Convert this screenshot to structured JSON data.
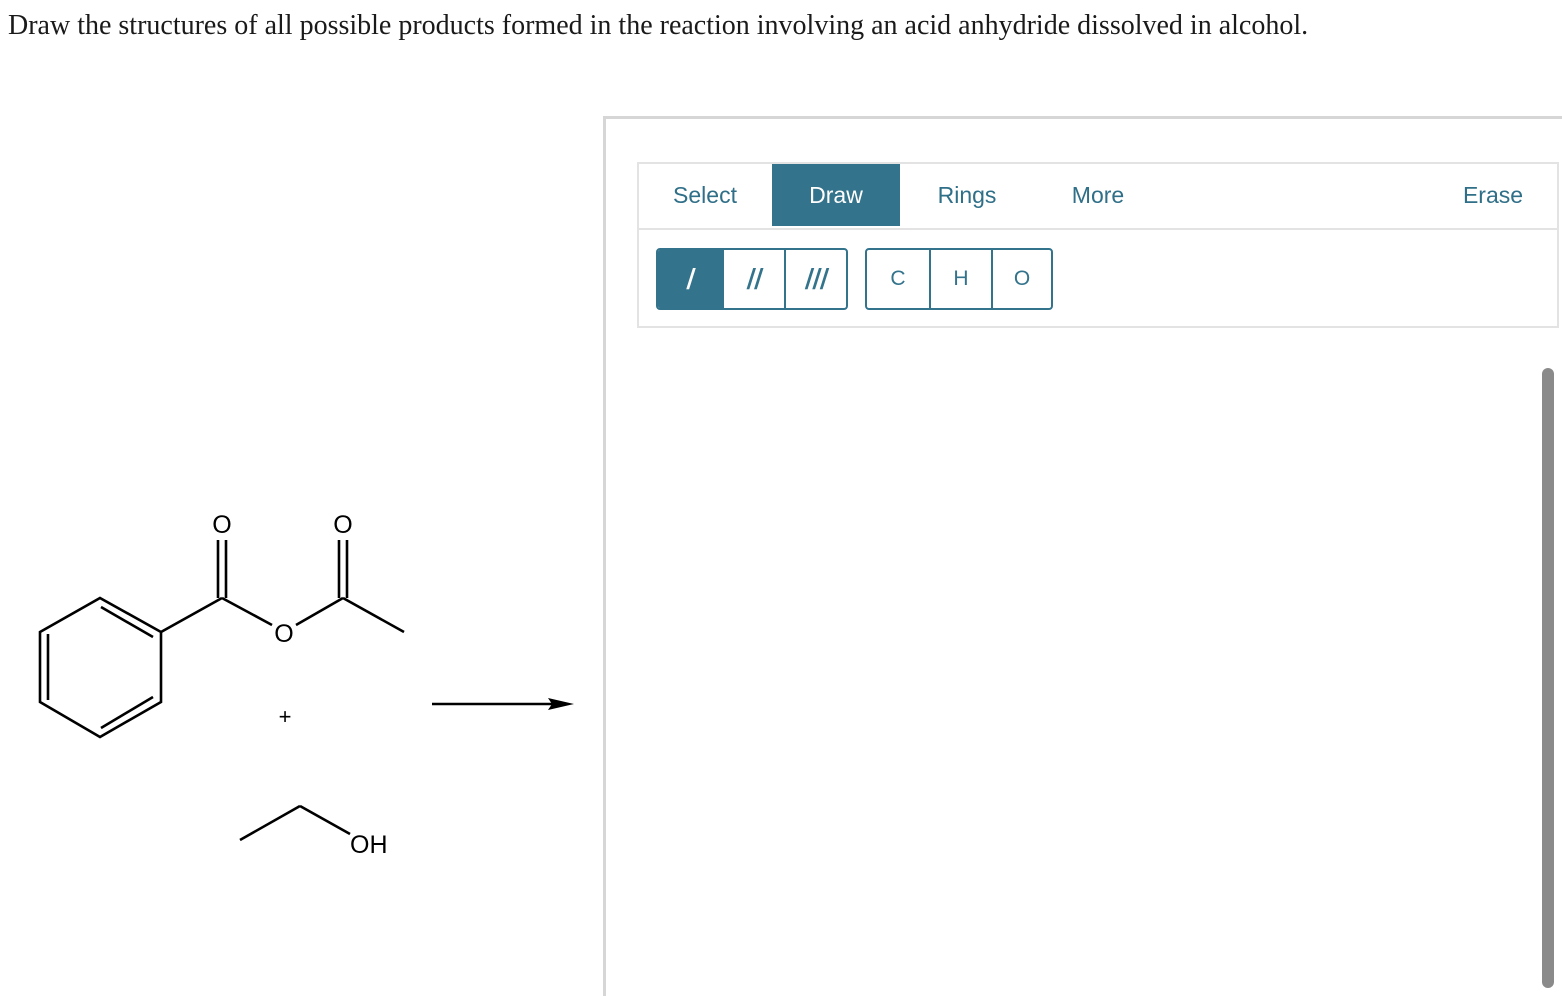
{
  "question": "Draw the structures of all possible products formed in the reaction involving an acid anhydride dissolved in alcohol.",
  "reaction": {
    "anhydride_labels": {
      "carbonyl_o_1": "O",
      "carbonyl_o_2": "O",
      "bridge_o": "O"
    },
    "plus_sign": "+",
    "alcohol_label": "OH"
  },
  "toolbar": {
    "tabs": {
      "select": "Select",
      "draw": "Draw",
      "rings": "Rings",
      "more": "More",
      "erase": "Erase"
    },
    "active_tab": "Draw",
    "bond_buttons": {
      "single": "/",
      "double": "//",
      "triple": "///"
    },
    "atom_buttons": {
      "carbon": "C",
      "hydrogen": "H",
      "oxygen": "O"
    }
  },
  "colors": {
    "accent": "#33738c",
    "tab_text": "#2f6f88",
    "border": "#e3e3e3"
  }
}
